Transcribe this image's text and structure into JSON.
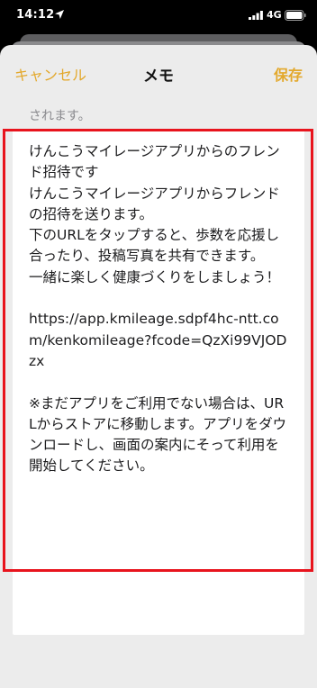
{
  "status_bar": {
    "time": "14:12",
    "network": "4G"
  },
  "nav": {
    "cancel_label": "キャンセル",
    "title": "メモ",
    "save_label": "保存",
    "accent_color": "#e3a82b"
  },
  "preview_text": "されます。",
  "message": {
    "body": "けんこうマイレージアプリからのフレンド招待です\nけんこうマイレージアプリからフレンドの招待を送ります。\n下のURLをタップすると、歩数を応援し合ったり、投稿写真を共有できます。\n一緒に楽しく健康づくりをしましょう！\n\nhttps://app.kmileage.sdpf4hc-ntt.com/kenkomileage?fcode=QzXi99VJODzx\n\n※まだアプリをご利用でない場合は、URLからストアに移動します。アプリをダウンロードし、画面の案内にそって利用を開始してください。"
  },
  "highlight_color": "#e8141d"
}
